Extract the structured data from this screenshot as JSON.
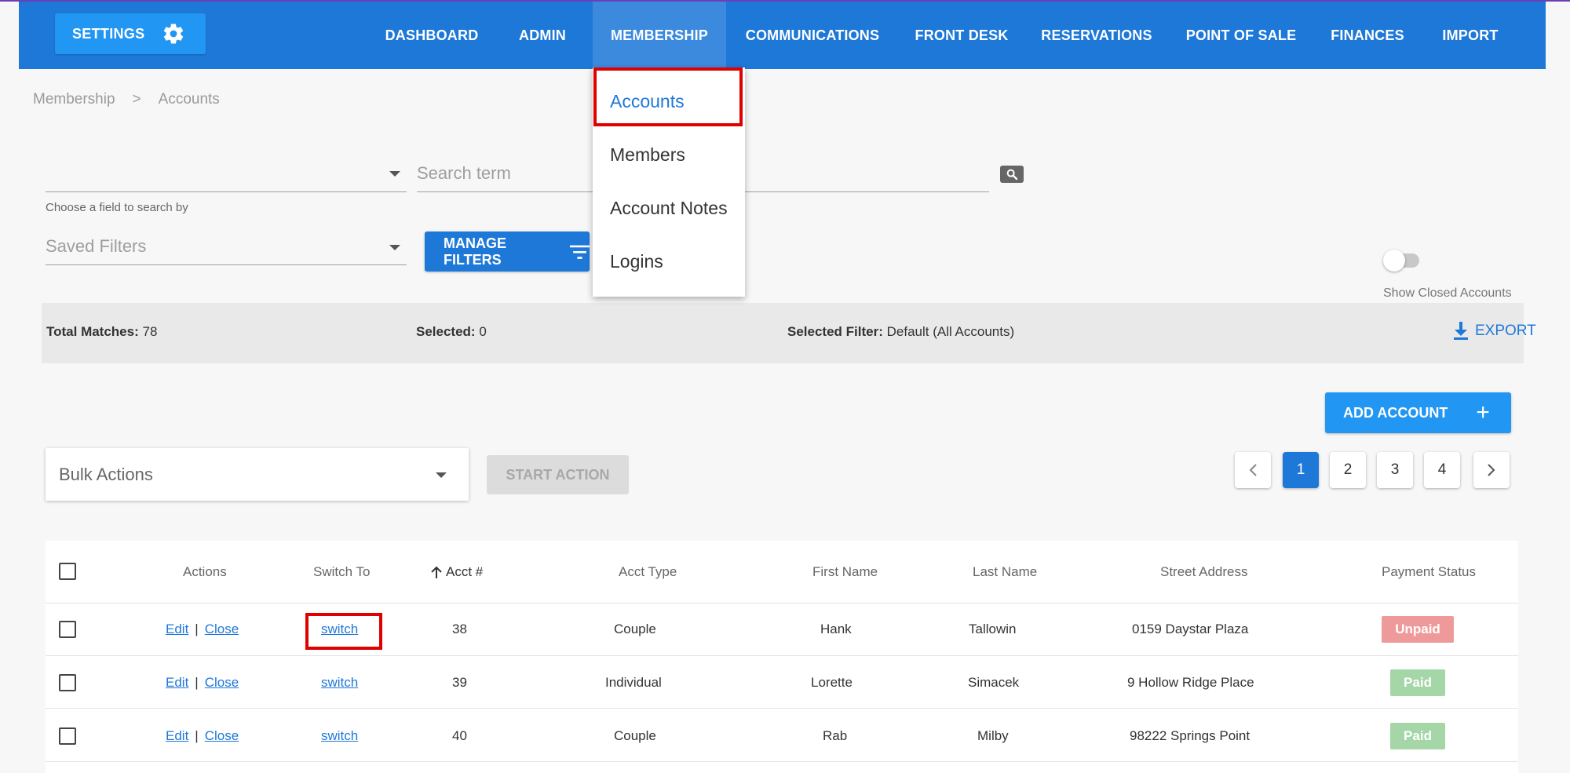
{
  "topbar": {
    "settings_label": "SETTINGS",
    "nav": [
      "DASHBOARD",
      "ADMIN",
      "MEMBERSHIP",
      "COMMUNICATIONS",
      "FRONT DESK",
      "RESERVATIONS",
      "POINT OF SALE",
      "FINANCES",
      "IMPORT"
    ],
    "active": "MEMBERSHIP",
    "color": "#1e78d8"
  },
  "dropdown": {
    "items": [
      "Accounts",
      "Members",
      "Account Notes",
      "Logins"
    ],
    "selected": "Accounts"
  },
  "breadcrumb": {
    "root": "Membership",
    "separator": ">",
    "current": "Accounts"
  },
  "search": {
    "field_helper": "Choose a field to search by",
    "term_placeholder": "Search term",
    "saved_filters_placeholder": "Saved Filters",
    "manage_filters_label": "MANAGE FILTERS",
    "show_closed_label": "Show Closed Accounts",
    "show_closed_on": false
  },
  "summary": {
    "total_label": "Total Matches:",
    "total_value": "78",
    "selected_label": "Selected:",
    "selected_value": "0",
    "filter_label": "Selected Filter:",
    "filter_value": "Default (All Accounts)",
    "export_label": "EXPORT"
  },
  "add_account_label": "ADD ACCOUNT",
  "bulk": {
    "placeholder": "Bulk Actions",
    "start_label": "START ACTION"
  },
  "pagination": {
    "pages": [
      "1",
      "2",
      "3",
      "4"
    ],
    "current": "1"
  },
  "table": {
    "headers": [
      "Actions",
      "Switch To",
      "Acct #",
      "Acct Type",
      "First Name",
      "Last Name",
      "Street Address",
      "Payment Status"
    ],
    "rows": [
      {
        "edit": "Edit",
        "close": "Close",
        "switch": "switch",
        "acct": "38",
        "type": "Couple",
        "first": "Hank",
        "last": "Tallowin",
        "address": "0159 Daystar Plaza",
        "status": "Unpaid"
      },
      {
        "edit": "Edit",
        "close": "Close",
        "switch": "switch",
        "acct": "39",
        "type": "Individual",
        "first": "Lorette",
        "last": "Simacek",
        "address": "9 Hollow Ridge Place",
        "status": "Paid"
      },
      {
        "edit": "Edit",
        "close": "Close",
        "switch": "switch",
        "acct": "40",
        "type": "Couple",
        "first": "Rab",
        "last": "Milby",
        "address": "98222 Springs Point",
        "status": "Paid"
      }
    ]
  }
}
